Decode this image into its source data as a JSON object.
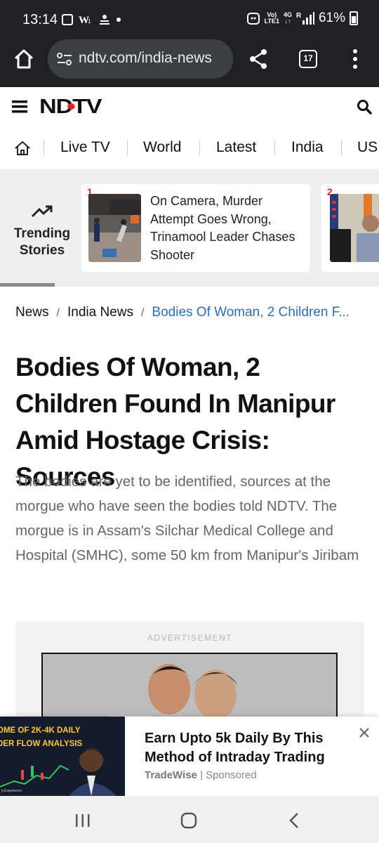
{
  "status_bar": {
    "time": "13:14",
    "network_top": "Vo)",
    "network_bottom": "LTE1",
    "gen": "4G",
    "signal": "R",
    "battery": "61%"
  },
  "browser": {
    "url": "ndtv.com/india-news",
    "tab_count": "17"
  },
  "site": {
    "logo": "NDTV"
  },
  "nav": {
    "items": [
      "Live TV",
      "World",
      "Latest",
      "India",
      "US"
    ]
  },
  "trending": {
    "label_line1": "Trending",
    "label_line2": "Stories",
    "cards": [
      {
        "rank": "1",
        "title": "On Camera, Murder Attempt Goes Wrong, Trinamool Leader Chases Shooter"
      },
      {
        "rank": "2",
        "title": ""
      }
    ]
  },
  "breadcrumb": {
    "items": [
      "News",
      "India News"
    ],
    "current": "Bodies Of Woman, 2 Children F...",
    "separator": "/"
  },
  "article": {
    "headline": "Bodies Of Woman, 2 Children Found In Manipur Amid Hostage Crisis: Sources",
    "summary": "The bodies are yet to be identified, sources at the morgue who have seen the bodies told NDTV. The morgue is in Assam's Silchar Medical College and Hospital (SMHC), some 50 km from Manipur's Jiribam"
  },
  "advertisement": {
    "label": "ADVERTISEMENT"
  },
  "sponsored": {
    "image_line1": "OME OF 2K-4K DAILY",
    "image_line2": "DER FLOW ANALYSIS",
    "image_footer": "g Experience",
    "title": "Earn Upto 5k Daily By This Method of Intraday Trading",
    "advertiser": "TradeWise",
    "divider": " | ",
    "tag": "Sponsored"
  },
  "colors": {
    "brand_red": "#e32526",
    "link_blue": "#2a6ebb",
    "chrome_dark": "#202124",
    "accent_yellow": "#ffc734"
  },
  "icons": [
    "image-icon",
    "w-app-icon",
    "app-icon",
    "notification-dot-icon",
    "alarm-icon",
    "wifi-signal-icon",
    "battery-icon",
    "home-icon",
    "site-settings-icon",
    "share-icon",
    "tabs-icon",
    "more-icon",
    "menu-icon",
    "search-icon",
    "trending-icon",
    "close-icon",
    "recents-icon",
    "home-nav-icon",
    "back-icon"
  ]
}
